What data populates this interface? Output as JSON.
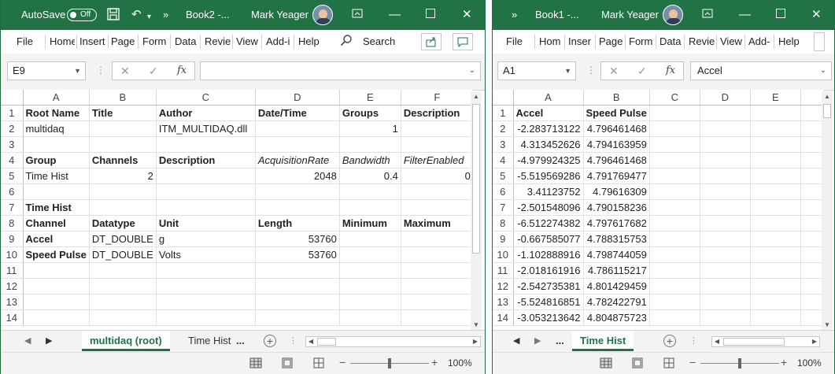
{
  "window1": {
    "autosave_label": "AutoSave",
    "autosave_state": "Off",
    "title": "Book2  -...",
    "user": "Mark Yeager",
    "menu": [
      "File",
      "Home",
      "Insert",
      "Page",
      "Form",
      "Data",
      "Revie",
      "View",
      "Add-i",
      "Help"
    ],
    "search_label": "Search",
    "name_box": "E9",
    "formula": "",
    "columns": [
      "A",
      "B",
      "C",
      "D",
      "E",
      "F"
    ],
    "rows": [
      {
        "n": "1",
        "cells": [
          "Root Name",
          "Title",
          "Author",
          "Date/Time",
          "Groups",
          "Description"
        ]
      },
      {
        "n": "2",
        "cells": [
          "multidaq",
          "",
          "ITM_MULTIDAQ.dll",
          "",
          "1",
          ""
        ]
      },
      {
        "n": "3",
        "cells": [
          "",
          "",
          "",
          "",
          "",
          ""
        ]
      },
      {
        "n": "4",
        "cells": [
          "Group",
          "Channels",
          "Description",
          "AcquisitionRate",
          "Bandwidth",
          "FilterEnabled"
        ]
      },
      {
        "n": "5",
        "cells": [
          "Time Hist",
          "2",
          "",
          "2048",
          "0.4",
          "0"
        ]
      },
      {
        "n": "6",
        "cells": [
          "",
          "",
          "",
          "",
          "",
          ""
        ]
      },
      {
        "n": "7",
        "cells": [
          "Time Hist",
          "",
          "",
          "",
          "",
          ""
        ]
      },
      {
        "n": "8",
        "cells": [
          "Channel",
          "Datatype",
          "Unit",
          "Length",
          "Minimum",
          "Maximum"
        ]
      },
      {
        "n": "9",
        "cells": [
          "Accel",
          "DT_DOUBLE",
          "g",
          "53760",
          "",
          ""
        ]
      },
      {
        "n": "10",
        "cells": [
          "Speed Pulse",
          "DT_DOUBLE",
          "Volts",
          "53760",
          "",
          ""
        ]
      },
      {
        "n": "11",
        "cells": [
          "",
          "",
          "",
          "",
          "",
          ""
        ]
      },
      {
        "n": "12",
        "cells": [
          "",
          "",
          "",
          "",
          "",
          ""
        ]
      },
      {
        "n": "13",
        "cells": [
          "",
          "",
          "",
          "",
          "",
          ""
        ]
      },
      {
        "n": "14",
        "cells": [
          "",
          "",
          "",
          "",
          "",
          ""
        ]
      }
    ],
    "tabs": [
      "multidaq (root)",
      "Time Hist"
    ],
    "tab_more": "...",
    "zoom": "100%"
  },
  "window2": {
    "title": "Book1  -...",
    "user": "Mark Yeager",
    "menu": [
      "File",
      "Hom",
      "Inser",
      "Page",
      "Form",
      "Data",
      "Revie",
      "View",
      "Add-",
      "Help"
    ],
    "name_box": "A1",
    "formula": "Accel",
    "columns": [
      "A",
      "B",
      "C",
      "D",
      "E"
    ],
    "rows": [
      {
        "n": "1",
        "cells": [
          "Accel",
          "Speed Pulse",
          "",
          "",
          ""
        ]
      },
      {
        "n": "2",
        "cells": [
          "-2.283713122",
          "4.796461468",
          "",
          "",
          ""
        ]
      },
      {
        "n": "3",
        "cells": [
          "4.313452626",
          "4.794163959",
          "",
          "",
          ""
        ]
      },
      {
        "n": "4",
        "cells": [
          "-4.979924325",
          "4.796461468",
          "",
          "",
          ""
        ]
      },
      {
        "n": "5",
        "cells": [
          "-5.519569286",
          "4.791769477",
          "",
          "",
          ""
        ]
      },
      {
        "n": "6",
        "cells": [
          "3.41123752",
          "4.79616309",
          "",
          "",
          ""
        ]
      },
      {
        "n": "7",
        "cells": [
          "-2.501548096",
          "4.790158236",
          "",
          "",
          ""
        ]
      },
      {
        "n": "8",
        "cells": [
          "-6.512274382",
          "4.797617682",
          "",
          "",
          ""
        ]
      },
      {
        "n": "9",
        "cells": [
          "-0.667585077",
          "4.788315753",
          "",
          "",
          ""
        ]
      },
      {
        "n": "10",
        "cells": [
          "-1.102888916",
          "4.798744059",
          "",
          "",
          ""
        ]
      },
      {
        "n": "11",
        "cells": [
          "-2.018161916",
          "4.786115217",
          "",
          "",
          ""
        ]
      },
      {
        "n": "12",
        "cells": [
          "-2.542735381",
          "4.801429459",
          "",
          "",
          ""
        ]
      },
      {
        "n": "13",
        "cells": [
          "-5.524816851",
          "4.782422791",
          "",
          "",
          ""
        ]
      },
      {
        "n": "14",
        "cells": [
          "-3.053213642",
          "4.804875723",
          "",
          "",
          ""
        ]
      }
    ],
    "tabs": [
      "Time Hist"
    ],
    "tab_more": "...",
    "zoom": "100%"
  },
  "icons": {
    "fx": "fx",
    "cancel": "✕",
    "enter": "✓"
  },
  "colors": {
    "excel_green": "#217346"
  }
}
